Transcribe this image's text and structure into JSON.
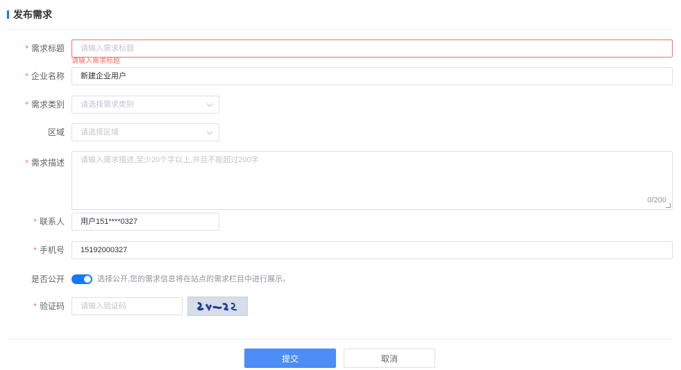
{
  "page": {
    "title": "发布需求"
  },
  "form": {
    "title_field": {
      "label": "需求标题",
      "required": "*",
      "placeholder": "请输入需求标题",
      "error": "请输入需求标题"
    },
    "company_field": {
      "label": "企业名称",
      "required": "*",
      "value": "新建企业用户"
    },
    "category_field": {
      "label": "需求类别",
      "required": "*",
      "placeholder": "请选择需求类别"
    },
    "region_field": {
      "label": "区域",
      "placeholder": "请选择区域"
    },
    "description_field": {
      "label": "需求描述",
      "required": "*",
      "placeholder": "请输入需求描述,至少20个字以上,并且不能超过200字",
      "counter": "0/200"
    },
    "contact_field": {
      "label": "联系人",
      "required": "*",
      "value": "用户151****0327"
    },
    "phone_field": {
      "label": "手机号",
      "required": "*",
      "value": "15192000327"
    },
    "public_field": {
      "label": "是否公开",
      "enabled": true,
      "hint": "选择公开,您的需求信息将在站点的需求栏目中进行展示。"
    },
    "captcha_field": {
      "label": "验证码",
      "required": "*",
      "placeholder": "请输入验证码"
    }
  },
  "buttons": {
    "submit": "提交",
    "cancel": "取消"
  },
  "colors": {
    "accent": "#1677ff",
    "primary_button": "#4c8df6",
    "error": "#f56c6c"
  }
}
